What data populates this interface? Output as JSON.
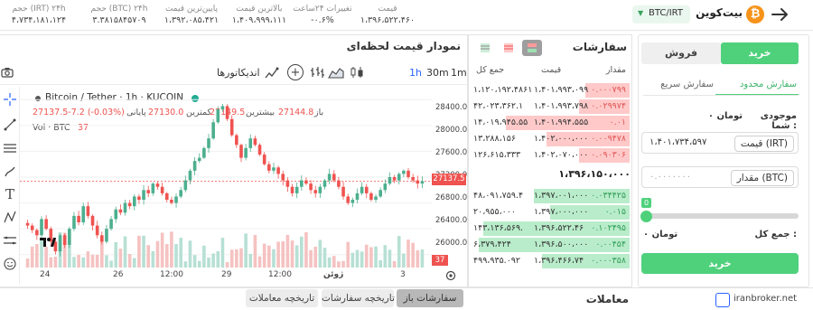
{
  "header": {
    "coin_name": "بیت‌کوین",
    "pair_badge": "BTC/IRT",
    "stats": [
      {
        "label": "قیمت",
        "value": "۱،۳۹۶،۵۲۲،۴۶۰",
        "color": "#444"
      },
      {
        "label": "تغییرات ۲۴ساعت",
        "value": "-۰.۶%",
        "color": "#444"
      },
      {
        "label": "بالاترین قیمت",
        "value": "۱،۴۰۹،۹۹۹،۱۱۱",
        "color": "#444"
      },
      {
        "label": "پایین‌ترین قیمت",
        "value": "۱،۳۹۲،۰۸۵،۴۲۱",
        "color": "#444"
      },
      {
        "label": "حجم (BTC) ۲۴h",
        "value": "۳.۳۸۱۵۸۴۵۷۰۹",
        "color": "#444"
      },
      {
        "label": "حجم (IRT) ۲۴h",
        "value": "۴،۷۳۴،۱۸۱،۱۲۴",
        "color": "#444"
      }
    ]
  },
  "chart": {
    "panel_title": "نمودار قیمت لحظه‌ای",
    "toolbar": {
      "intervals": [
        "1m",
        "30m",
        "1h"
      ],
      "active_interval": "1h",
      "indicators_label": "اندیکاتورها"
    },
    "legend": {
      "symbol": "Bitcoin / Tether · 1h · KUCOIN",
      "open_label": "باز",
      "open_value": "27144.8",
      "high_label": "بیشترین",
      "high_value": "27149.5",
      "low_label": "کمترین",
      "low_value": "27130.0",
      "close_label": "پایانی",
      "close_value": "27137.5-7.2 (-0.03%)",
      "vol_label": "Vol · BTC",
      "vol_value": "37"
    },
    "price_ticks": [
      "28400.0",
      "28000.0",
      "27600.0",
      "27200.0",
      "26800.0",
      "26400.0",
      "26000.0"
    ],
    "current_price_tag": "27137.5",
    "vol_tag": "37",
    "time_ticks": [
      "24",
      "26",
      "12:00",
      "29",
      "12:00",
      "ژوئن",
      "3"
    ],
    "tv_logo": "TV"
  },
  "chart_data": {
    "type": "candlestick",
    "title": "Bitcoin / Tether · 1h · KUCOIN",
    "ylim": [
      25800,
      28600
    ],
    "x_ticks": [
      "24",
      "26",
      "12:00",
      "29",
      "12:00",
      "ژوئن",
      "3"
    ],
    "close_series": [
      26450,
      26380,
      26300,
      26550,
      26400,
      26200,
      26050,
      26300,
      26150,
      26400,
      26600,
      26500,
      26750,
      26600,
      26450,
      26300,
      26200,
      26400,
      26550,
      26700,
      26650,
      26800,
      26750,
      26900,
      26850,
      27000,
      26950,
      27100,
      27050,
      26950,
      26850,
      26800,
      26900,
      27000,
      27150,
      27300,
      27450,
      27500,
      27650,
      27800,
      28050,
      28250,
      28300,
      28100,
      27850,
      27700,
      27500,
      27650,
      27800,
      27700,
      27550,
      27400,
      27300,
      27350,
      27250,
      27150,
      27050,
      26950,
      27050,
      27150,
      27100,
      27000,
      26950,
      27050,
      27150,
      27250,
      27150,
      27050,
      26900,
      26800,
      26850,
      26950,
      27050,
      26950,
      26850,
      26900,
      27000,
      27100,
      27200,
      27150,
      27250,
      27300,
      27200,
      27150,
      27100,
      27137.5
    ]
  },
  "orderbook": {
    "title": "سفارشات",
    "headers": {
      "amount": "مقدار",
      "price": "قیمت",
      "total": "جمع کل"
    },
    "asks": [
      {
        "amount": "۰.۰۰۰۷۹۹",
        "price": "۱،۴۰۱،۹۹۳،۰۹۹",
        "total": "۱،۱۲۰،۱۹۲،۴۸۶۱",
        "depth": 0.28
      },
      {
        "amount": "۰.۰۲۹۹۷۴",
        "price": "۱،۴۰۱،۹۹۳،۷۹۸",
        "total": "۴۲،۰۲۳،۳۶۲.۱",
        "depth": 0.32
      },
      {
        "amount": "۰.۰۱",
        "price": "۱،۴۰۱،۹۹۴،۵۵۵",
        "total": "۱۴،۰۱۹،۹۴۵.۵۵",
        "depth": 0.78
      },
      {
        "amount": "۰.۰۰۹۴۷۸",
        "price": "۱،۴۰۲،۰۰۰،۰۰۰",
        "total": "۱۳،۲۸۸،۱۵۶",
        "depth": 0.52
      },
      {
        "amount": "۰.۰۹۰۳۰۶",
        "price": "۱،۴۰۲،۰۷۰،۰۰۰",
        "total": "۱۲۶،۶۱۵،۳۳۳",
        "depth": 0.32
      }
    ],
    "last_price": "۱،۳۹۶،۱۵۰،۰۰۰",
    "bids": [
      {
        "amount": "۰.۰۳۴۴۲۵",
        "price": "۱،۳۹۷،۰۰۱،۰۰۰",
        "total": "۴۸،۰۹۱،۷۵۹.۴",
        "depth": 0.6
      },
      {
        "amount": "۰.۰۱۵",
        "price": "۱،۳۹۷،۰۰۰،۰۰۰",
        "total": "۲۰،۹۵۵،۰۰۰",
        "depth": 0.5
      },
      {
        "amount": "۰.۱۰۲۴۹۵",
        "price": "۱،۳۹۶،۵۲۲،۴۶",
        "total": "۱۴۳،۱۳۶،۵۶۹.",
        "depth": 0.92
      },
      {
        "amount": "۰.۰۰۴۵۴",
        "price": "۱،۳۹۶،۵۰۰،۰۰۰",
        "total": "۶،۳۷۹،۴۲۴",
        "depth": 0.95
      },
      {
        "amount": "۰.۰۰۰۳۵۸",
        "price": "۱،۳۹۶،۴۶۶،۷۴",
        "total": "۴۹۹،۹۳۵.۰۹۲",
        "depth": 0.55
      }
    ]
  },
  "trade_form": {
    "buy_tab": "خرید",
    "sell_tab": "فروش",
    "limit_tab": "سفارش محدود",
    "market_tab": "سفارش سریع",
    "balance_label": "موجودی شما :",
    "balance_value": "۰ تومان",
    "price_label": "قیمت (IRT)",
    "price_value": "۱،۴۰۱،۷۳۴،۵۹۷",
    "amount_label": "مقدار (BTC)",
    "amount_placeholder": "۰.۰۰۰۰۰۰۰",
    "slider_value": "0",
    "slider_fraction": 0,
    "total_label": "جمع کل :",
    "total_value": "۰ تومان",
    "submit": "خرید"
  },
  "bottom": {
    "trades_label": "معاملات",
    "tabs": [
      "سفارشات باز",
      "تاریخچه سفارشات",
      "تاریخچه معاملات"
    ],
    "watermark": "iranbroker.net"
  },
  "colors": {
    "buy": "#4fd17c",
    "sell": "#ff7b7b",
    "bid_bg": "#b9ecca",
    "ask_bg": "#ffc9c9",
    "candle_up": "#4caf8f",
    "candle_down": "#ef5350",
    "bitcoin": "#f7931a"
  }
}
